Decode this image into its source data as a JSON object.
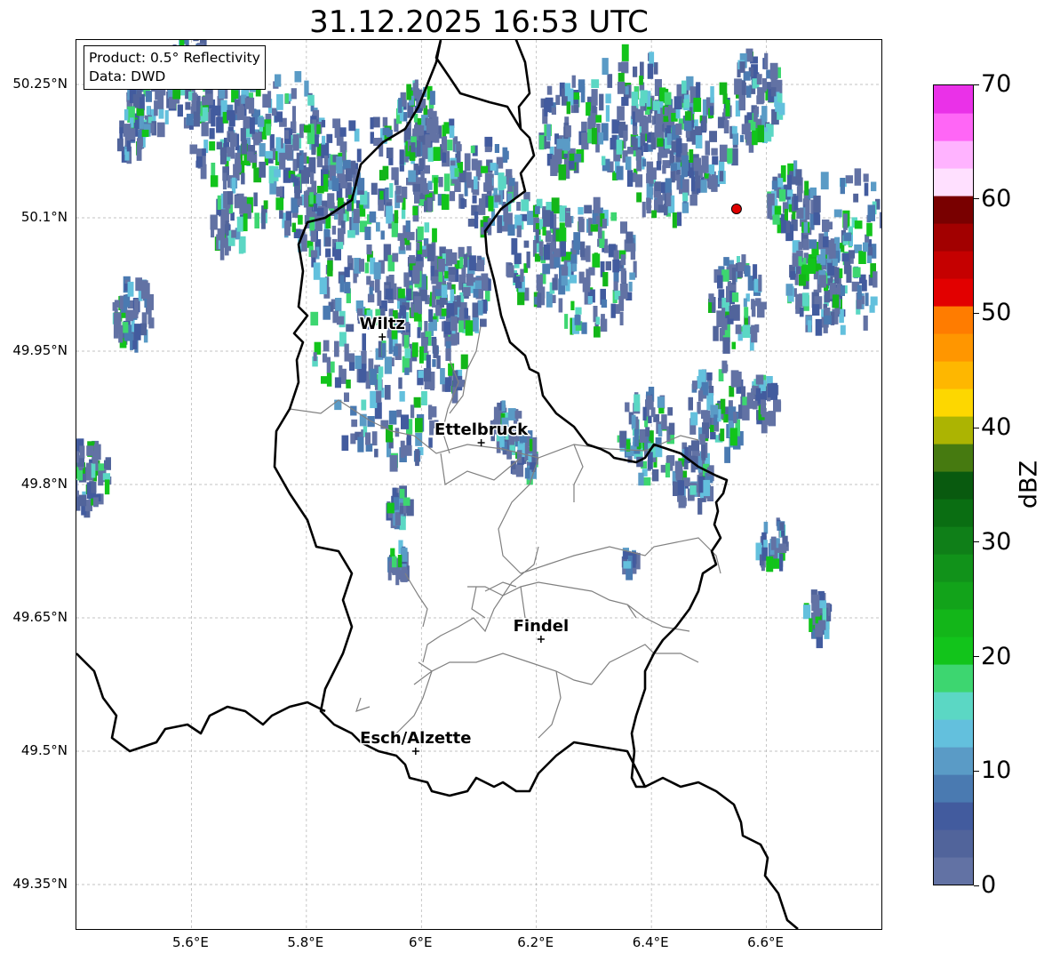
{
  "title": "31.12.2025 16:53 UTC",
  "info": {
    "product": "Product: 0.5° Reflectivity",
    "data": "Data: DWD"
  },
  "map": {
    "lon_range": [
      5.4,
      6.8
    ],
    "lat_range": [
      49.3,
      50.3
    ],
    "lon_ticks": [
      "5.6°E",
      "5.8°E",
      "6°E",
      "6.2°E",
      "6.4°E",
      "6.6°E"
    ],
    "lon_tick_values": [
      5.6,
      5.8,
      6.0,
      6.2,
      6.4,
      6.6
    ],
    "lat_ticks": [
      "50.25°N",
      "50.1°N",
      "49.95°N",
      "49.8°N",
      "49.65°N",
      "49.5°N",
      "49.35°N"
    ],
    "lat_tick_values": [
      50.25,
      50.1,
      49.95,
      49.8,
      49.65,
      49.5,
      49.35
    ],
    "gridlines": true,
    "radar_site": {
      "lon": 6.548,
      "lat": 50.11,
      "color": "#e00000"
    }
  },
  "cities": [
    {
      "name": "Wiltz",
      "lon": 5.932,
      "lat": 49.966
    },
    {
      "name": "Ettelbruck",
      "lon": 6.104,
      "lat": 49.847
    },
    {
      "name": "Findel",
      "lon": 6.208,
      "lat": 49.626
    },
    {
      "name": "Esch/Alzette",
      "lon": 5.99,
      "lat": 49.5
    }
  ],
  "colorbar": {
    "label": "dBZ",
    "min": 0,
    "max": 70,
    "ticks": [
      "0",
      "10",
      "20",
      "30",
      "40",
      "50",
      "60",
      "70"
    ],
    "tick_values": [
      0,
      10,
      20,
      30,
      40,
      50,
      60,
      70
    ],
    "colors": [
      "#6272a4",
      "#51649b",
      "#425b9e",
      "#4a7ab1",
      "#5a9bc6",
      "#63c0dd",
      "#5bd7c4",
      "#3dd670",
      "#12c41b",
      "#13b619",
      "#12a31a",
      "#11921a",
      "#0f7f18",
      "#0a6e12",
      "#095a0f",
      "#467a10",
      "#acb402",
      "#fdd700",
      "#feb700",
      "#ff9600",
      "#ff7c00",
      "#e20000",
      "#c50000",
      "#a20000",
      "#790000",
      "#ffe0ff",
      "#ffb3ff",
      "#ff66f6",
      "#ea31e8"
    ]
  }
}
